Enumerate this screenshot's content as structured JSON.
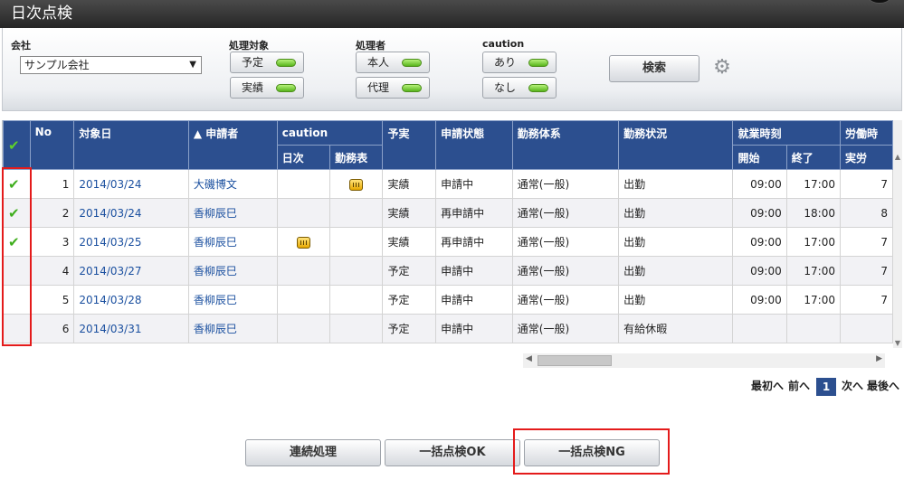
{
  "window": {
    "title": "日次点検"
  },
  "filters": {
    "company_label": "会社",
    "company_value": "サンプル会社",
    "target_label": "処理対象",
    "target_buttons": [
      "予定",
      "実績"
    ],
    "processor_label": "処理者",
    "processor_buttons": [
      "本人",
      "代理"
    ],
    "caution_label": "caution",
    "caution_buttons": [
      "あり",
      "なし"
    ],
    "search_label": "検索"
  },
  "table": {
    "headers": {
      "no": "No",
      "date": "対象日",
      "applicant": "▲ 申請者",
      "caution": "caution",
      "caution_daily": "日次",
      "caution_schedule": "勤務表",
      "plan_actual": "予実",
      "status": "申請状態",
      "work_system": "勤務体系",
      "work_status": "勤務状況",
      "work_time": "就業時刻",
      "start": "開始",
      "end": "終了",
      "labor": "労働時",
      "actual": "実労"
    },
    "rows": [
      {
        "checked": true,
        "no": "1",
        "date": "2014/03/24",
        "applicant": "大磯博文",
        "daily_icon": false,
        "schedule_icon": true,
        "plan_actual": "実績",
        "status": "申請中",
        "work_system": "通常(一般)",
        "work_status": "出勤",
        "start": "09:00",
        "end": "17:00",
        "actual": "7"
      },
      {
        "checked": true,
        "no": "2",
        "date": "2014/03/24",
        "applicant": "香柳辰巳",
        "daily_icon": false,
        "schedule_icon": false,
        "plan_actual": "実績",
        "status": "再申請中",
        "work_system": "通常(一般)",
        "work_status": "出勤",
        "start": "09:00",
        "end": "18:00",
        "actual": "8"
      },
      {
        "checked": true,
        "no": "3",
        "date": "2014/03/25",
        "applicant": "香柳辰巳",
        "daily_icon": true,
        "schedule_icon": false,
        "plan_actual": "実績",
        "status": "再申請中",
        "work_system": "通常(一般)",
        "work_status": "出勤",
        "start": "09:00",
        "end": "17:00",
        "actual": "7"
      },
      {
        "checked": false,
        "no": "4",
        "date": "2014/03/27",
        "applicant": "香柳辰巳",
        "daily_icon": false,
        "schedule_icon": false,
        "plan_actual": "予定",
        "status": "申請中",
        "work_system": "通常(一般)",
        "work_status": "出勤",
        "start": "09:00",
        "end": "17:00",
        "actual": "7"
      },
      {
        "checked": false,
        "no": "5",
        "date": "2014/03/28",
        "applicant": "香柳辰巳",
        "daily_icon": false,
        "schedule_icon": false,
        "plan_actual": "予定",
        "status": "申請中",
        "work_system": "通常(一般)",
        "work_status": "出勤",
        "start": "09:00",
        "end": "17:00",
        "actual": "7"
      },
      {
        "checked": false,
        "no": "6",
        "date": "2014/03/31",
        "applicant": "香柳辰巳",
        "daily_icon": false,
        "schedule_icon": false,
        "plan_actual": "予定",
        "status": "申請中",
        "work_system": "通常(一般)",
        "work_status": "有給休暇",
        "start": "",
        "end": "",
        "actual": ""
      }
    ]
  },
  "pager": {
    "first": "最初へ",
    "prev": "前へ",
    "current": "1",
    "next": "次へ",
    "last": "最後へ"
  },
  "actions": {
    "continuous": "連続処理",
    "bulk_ok": "一括点検OK",
    "bulk_ng": "一括点検NG"
  }
}
